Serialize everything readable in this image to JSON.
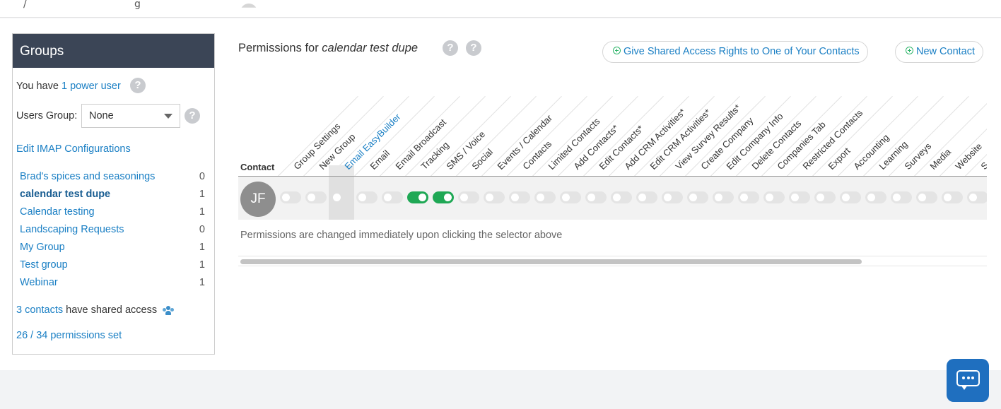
{
  "topbar": {
    "ghost_left": "/",
    "ghost_middle": "g"
  },
  "groups": {
    "title": "Groups",
    "you_have_prefix": "You have",
    "power_user_link": "1 power user",
    "users_group_label": "Users Group:",
    "users_group_value": "None",
    "imap_link": "Edit IMAP Configurations",
    "items": [
      {
        "name": "Brad's spices and seasonings",
        "count": "0"
      },
      {
        "name": "calendar test dupe",
        "count": "1"
      },
      {
        "name": "Calendar testing",
        "count": "1"
      },
      {
        "name": "Landscaping Requests",
        "count": "0"
      },
      {
        "name": "My Group",
        "count": "1"
      },
      {
        "name": "Test group",
        "count": "1"
      },
      {
        "name": "Webinar",
        "count": "1"
      }
    ],
    "shared_link": "3 contacts",
    "shared_suffix": "have shared access",
    "permissions_set": "26 / 34 permissions set"
  },
  "permissions": {
    "title_prefix": "Permissions for",
    "group_name": "calendar test dupe",
    "help_icon": "?",
    "give_access_button": "Give Shared Access Rights to One of Your Contacts",
    "new_contact_button": "New Contact",
    "contact_header": "Contact",
    "columns": [
      "Group Settings",
      "New Group",
      "Email EasyBuilder",
      "Email",
      "Email Broadcast",
      "Tracking",
      "SMS / Voice",
      "Social",
      "Events / Calendar",
      "Contacts",
      "Limited Contacts",
      "Add Contacts*",
      "Edit Contacts*",
      "Add CRM Activities*",
      "Edit CRM Activities*",
      "View Survey Results*",
      "Create Company",
      "Edit Company Info",
      "Delete Contacts",
      "Companies Tab",
      "Restricted Contacts",
      "Export",
      "Accounting",
      "Learning",
      "Surveys",
      "Media",
      "Website",
      "S"
    ],
    "contact_initials": "JF",
    "toggle_states": [
      false,
      false,
      "plain",
      false,
      false,
      true,
      true,
      false,
      false,
      false,
      false,
      false,
      false,
      false,
      false,
      false,
      false,
      false,
      false,
      false,
      false,
      false,
      false,
      false,
      false,
      false,
      false,
      false
    ],
    "note": "Permissions are changed immediately upon clicking the selector above",
    "scroll_fraction": 0.83
  },
  "colors": {
    "header_bg": "#3b4556",
    "link": "#1a7fc4",
    "toggle_on": "#1fa855",
    "chat": "#1f6fbf"
  },
  "icons": {
    "help": "question-circle-icon",
    "people": "people-icon",
    "chat": "chat-icon",
    "plus": "plus-circle-icon",
    "caret": "chevron-down-icon"
  }
}
